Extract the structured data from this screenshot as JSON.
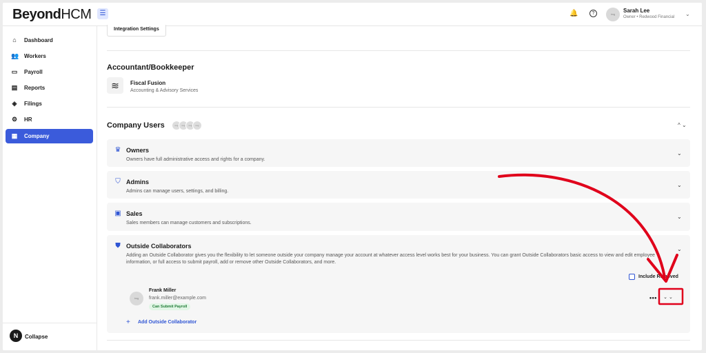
{
  "header": {
    "logo_bold": "Beyond",
    "logo_light": "HCM",
    "menu_icon": "hamburger-icon",
    "bell_icon": "bell-icon",
    "help_icon": "help-icon",
    "user": {
      "name": "Sarah Lee",
      "role": "Owner • Redwood Financial"
    }
  },
  "sidebar": {
    "items": [
      {
        "label": "Dashboard",
        "icon": "home-icon"
      },
      {
        "label": "Workers",
        "icon": "users-icon"
      },
      {
        "label": "Payroll",
        "icon": "wallet-icon"
      },
      {
        "label": "Reports",
        "icon": "document-icon"
      },
      {
        "label": "Filings",
        "icon": "tag-icon"
      },
      {
        "label": "HR",
        "icon": "gear-icon"
      },
      {
        "label": "Company",
        "icon": "building-icon"
      }
    ],
    "active": "Company",
    "collapse_badge": "N",
    "collapse_label": "Collapse"
  },
  "main": {
    "integration_button": "Integration Settings",
    "accountant": {
      "title": "Accountant/Bookkeeper",
      "firm_name": "Fiscal Fusion",
      "firm_sub": "Accounting & Advisory Services"
    },
    "company_users": {
      "title": "Company Users",
      "groups": [
        {
          "title": "Owners",
          "desc": "Owners have full administrative access and rights for a company.",
          "icon": "crown-icon"
        },
        {
          "title": "Admins",
          "desc": "Admins can manage users, settings, and billing.",
          "icon": "shield-check-icon"
        },
        {
          "title": "Sales",
          "desc": "Sales members can manage customers and subscriptions.",
          "icon": "briefcase-icon"
        },
        {
          "title": "Outside Collaborators",
          "desc": "Adding an Outside Collaborator gives you the flexibility to let someone outside your company manage your account at whatever access level works best for your business. You can grant Outside Collaborators basic access to view and edit employee information, or full access to submit payroll, add or remove other Outside Collaborators, and more.",
          "icon": "shield-user-icon"
        }
      ],
      "include_removed_label": "Include Removed",
      "collaborator": {
        "name": "Frank Miller",
        "email": "frank.miller@example.com",
        "badge": "Can Submit Payroll"
      },
      "add_label": "Add Outside Collaborator"
    }
  },
  "colors": {
    "accent": "#3b5bdb",
    "annotation": "#e0001b",
    "badge_bg": "#e2f6e6",
    "badge_text": "#1f7a35"
  }
}
